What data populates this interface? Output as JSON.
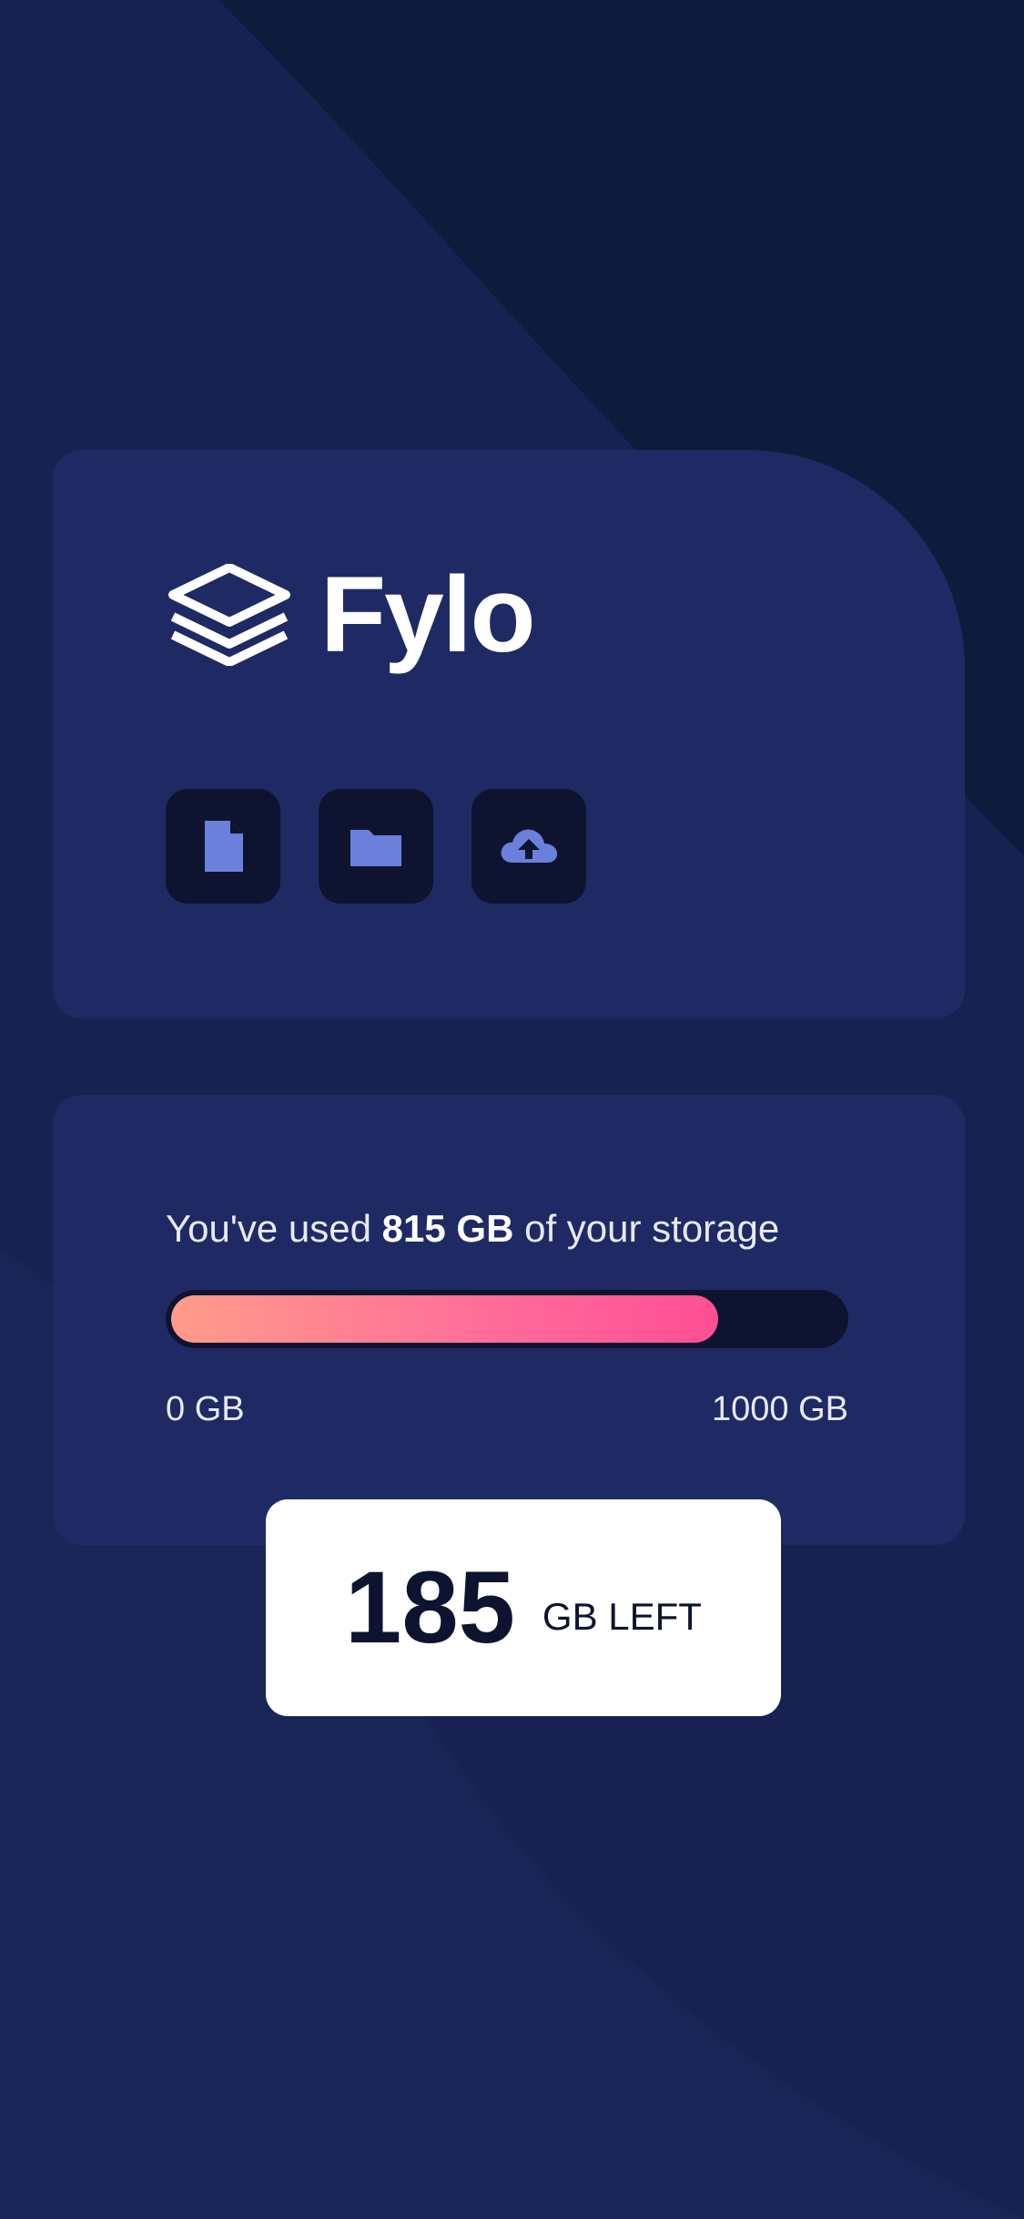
{
  "brand": {
    "logo_icon": "stacked-layers-icon",
    "name": "Fylo"
  },
  "actions": {
    "items": [
      {
        "icon": "document-icon"
      },
      {
        "icon": "folder-icon"
      },
      {
        "icon": "cloud-upload-icon"
      }
    ]
  },
  "storage": {
    "text_before": "You've used ",
    "used": "815 GB",
    "text_after": " of your storage",
    "progress": 0.815,
    "min_label": "0 GB",
    "max_label": "1000 GB",
    "remaining_value": "185",
    "remaining_label": "GB LEFT"
  },
  "colors": {
    "page_background": "#0f1b3c",
    "card_background": "#1f2a64",
    "icon_button_background": "#0e1430",
    "icon_color": "#6b7fdb",
    "gradient_start": "#ff9b8a",
    "gradient_end": "#ff4e94"
  }
}
